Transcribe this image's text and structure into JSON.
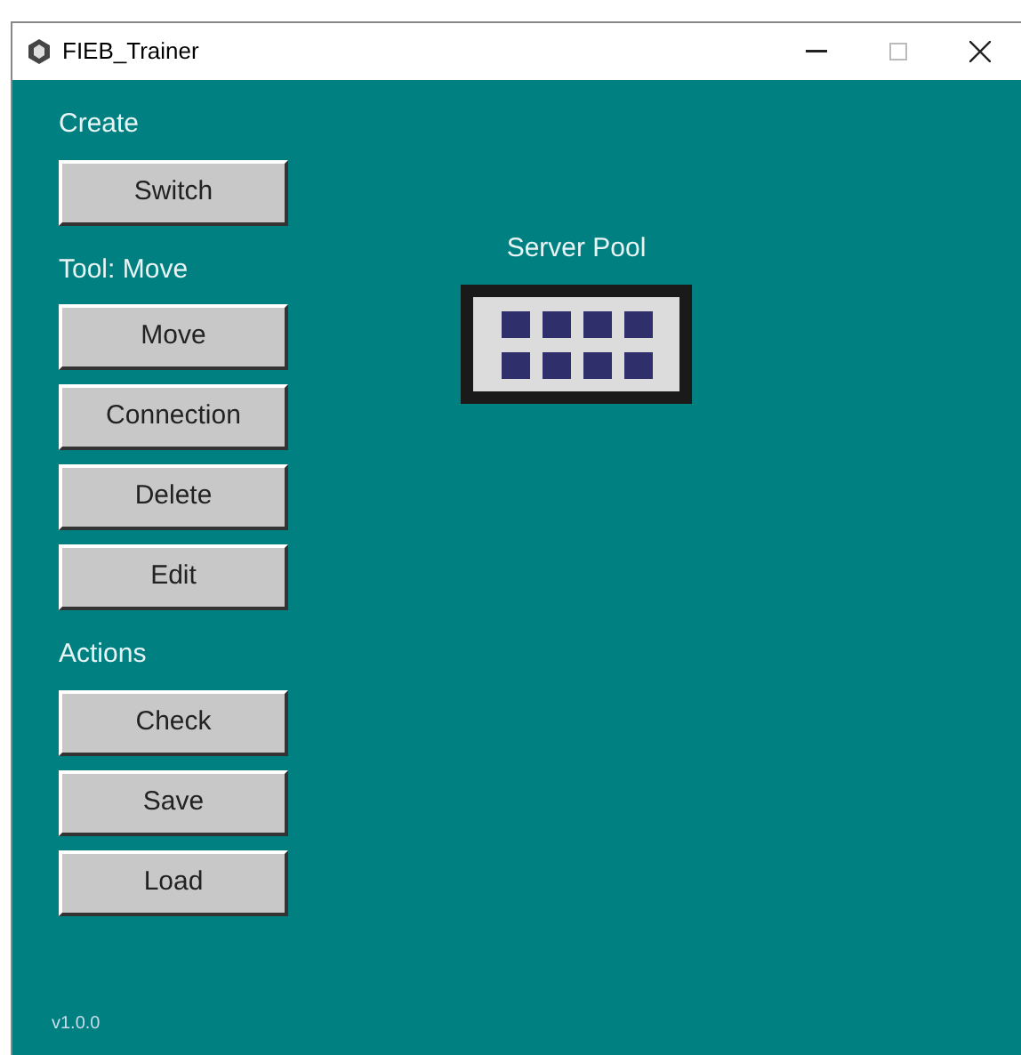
{
  "window": {
    "title": "FIEB_Trainer"
  },
  "sections": [
    {
      "title": "Create",
      "buttons": [
        "Switch"
      ]
    },
    {
      "title": "Tool: Move",
      "buttons": [
        "Move",
        "Connection",
        "Delete",
        "Edit"
      ]
    },
    {
      "title": "Actions",
      "buttons": [
        "Check",
        "Save",
        "Load"
      ]
    }
  ],
  "canvas": {
    "nodes": [
      {
        "label": "Server Pool"
      }
    ]
  },
  "version": "v1.0.0"
}
